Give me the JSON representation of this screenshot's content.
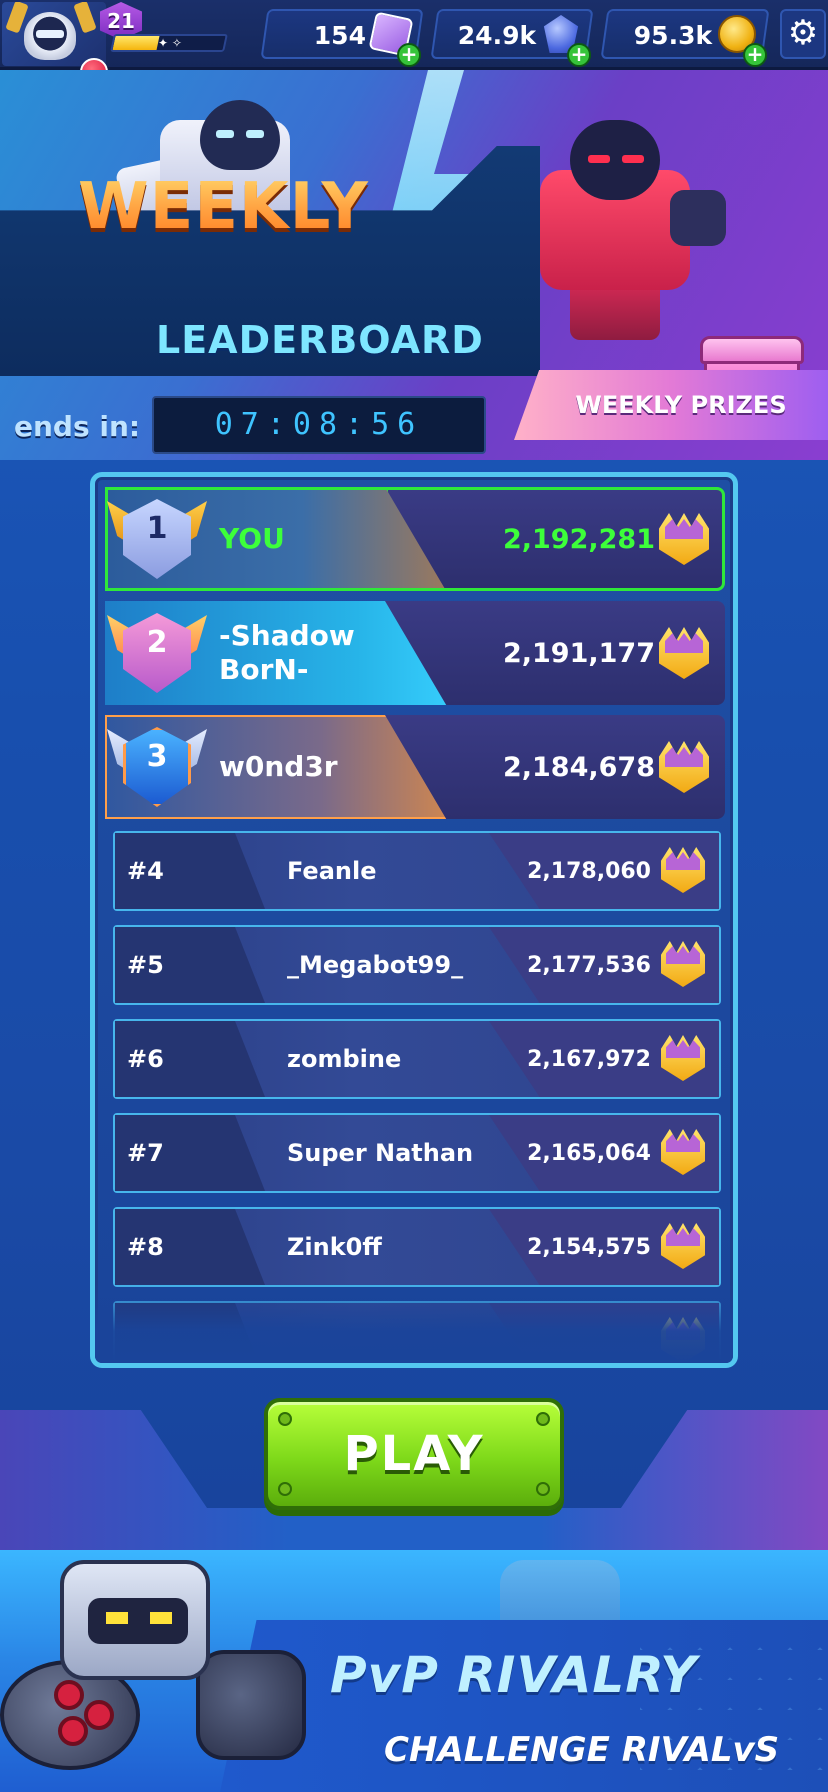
{
  "topbar": {
    "level": "21",
    "xp_progress": 0.4,
    "currencies": [
      {
        "name": "tickets",
        "amount": "154",
        "icon": "ticket-icon"
      },
      {
        "name": "gems",
        "amount": "24.9k",
        "icon": "gem-icon"
      },
      {
        "name": "coins",
        "amount": "95.3k",
        "icon": "coin-icon"
      }
    ],
    "add_label": "+",
    "settings_icon": "gear-icon",
    "settings_glyph": "⚙"
  },
  "hero": {
    "title_line1": "WEEKLY",
    "title_line2": "LEADERBOARD",
    "prizes_label": "WEEKLY PRIZES",
    "ends_label": "ends in:",
    "timer": "07:08:56"
  },
  "leaderboard": {
    "top": [
      {
        "rank": "1",
        "name": "YOU",
        "score": "2,192,281"
      },
      {
        "rank": "2",
        "name": "-Shadow BorN-",
        "score": "2,191,177"
      },
      {
        "rank": "3",
        "name": "w0nd3r",
        "score": "2,184,678"
      }
    ],
    "rows": [
      {
        "rank": "#4",
        "name": "Feanle",
        "score": "2,178,060"
      },
      {
        "rank": "#5",
        "name": "_Megabot99_",
        "score": "2,177,536"
      },
      {
        "rank": "#6",
        "name": "zombine",
        "score": "2,167,972"
      },
      {
        "rank": "#7",
        "name": "Super Nathan",
        "score": "2,165,064"
      },
      {
        "rank": "#8",
        "name": "Zink0ff",
        "score": "2,154,575"
      }
    ]
  },
  "play": {
    "label": "PLAY"
  },
  "promo": {
    "title": "PvP RIVALRY",
    "subtitle": "CHALLENGE RIVALvS"
  },
  "colors": {
    "accent_green": "#3dff3a",
    "board_border": "#54c8f0",
    "play_green": "#7ed91a",
    "title_orange": "#ffa040",
    "title_cyan": "#7ee6ff"
  }
}
